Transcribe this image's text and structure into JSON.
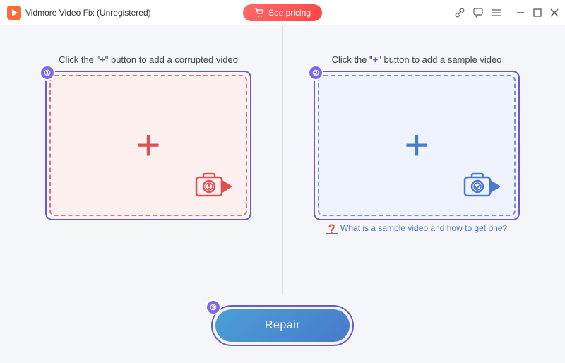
{
  "titlebar": {
    "app_name": "Vidmore Video Fix (Unregistered)",
    "see_pricing_label": "See pricing",
    "icons": {
      "link": "🔗",
      "chat": "💬",
      "menu": "≡"
    },
    "win_controls": {
      "minimize": "—",
      "maximize": "□",
      "close": "✕"
    }
  },
  "panel_left": {
    "instruction_prefix": "Click the \"",
    "instruction_plus": "+",
    "instruction_suffix": "\" button to add a corrupted video",
    "badge": "①",
    "badge_num": "1"
  },
  "panel_right": {
    "instruction_prefix": "Click the \"",
    "instruction_plus": "+",
    "instruction_suffix": "\" button to add a sample video",
    "badge": "②",
    "badge_num": "2",
    "help_text": "What is a sample video and how to get one?"
  },
  "repair_button": {
    "label": "Repair",
    "badge_num": "3"
  }
}
